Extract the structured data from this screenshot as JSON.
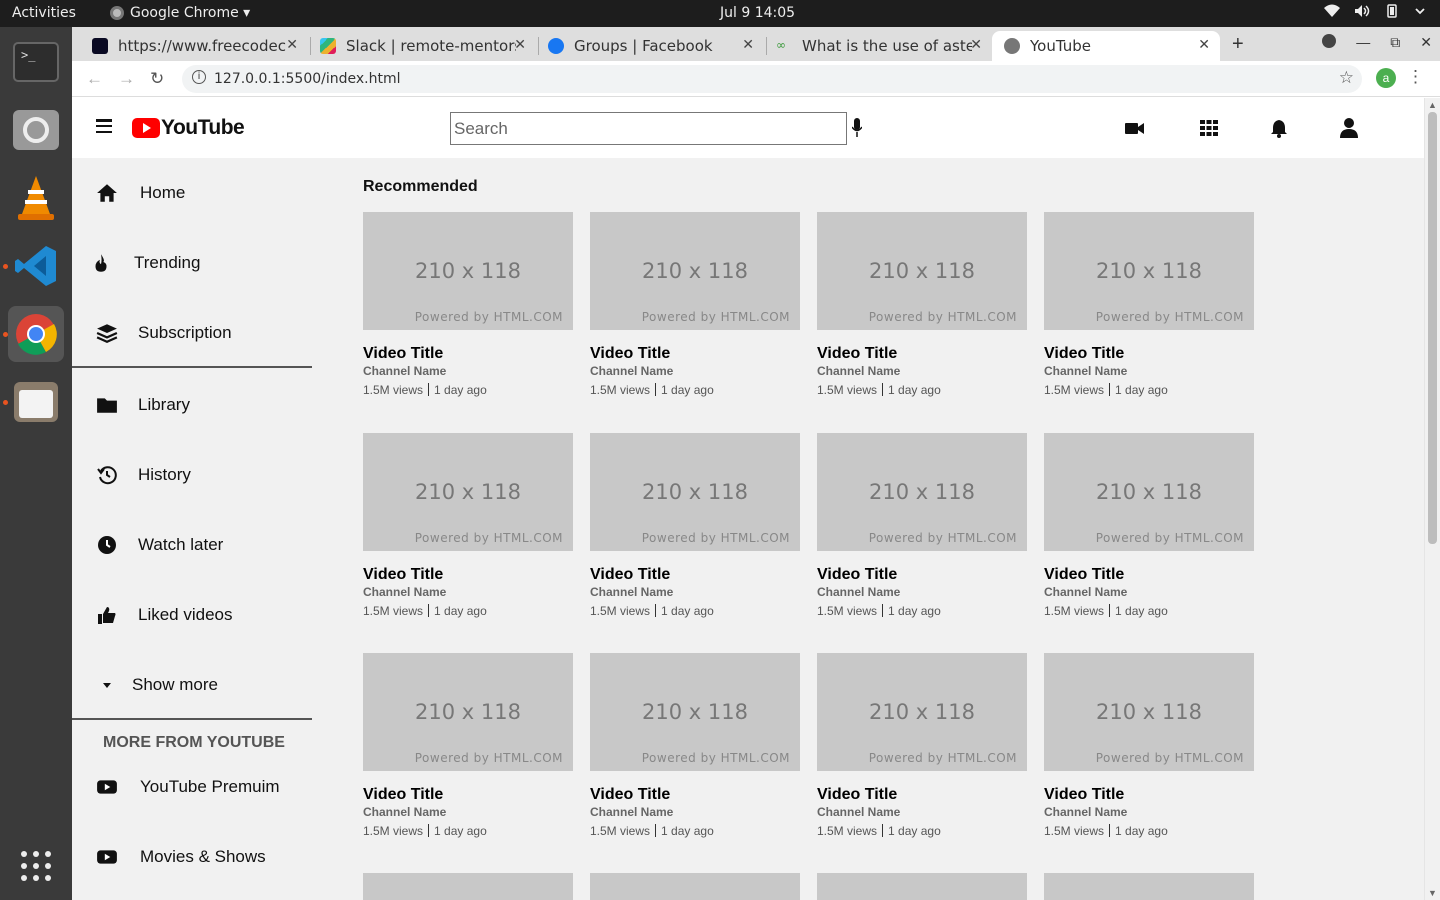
{
  "topbar": {
    "activities": "Activities",
    "app_name": "Google Chrome ▾",
    "datetime": "Jul 9  14:05",
    "tray": [
      "wifi-icon",
      "volume-icon",
      "battery-icon",
      "power-menu-icon"
    ]
  },
  "dock": {
    "items": [
      "terminal",
      "screenshot-tool",
      "vlc",
      "vscode",
      "chrome",
      "files"
    ],
    "show_apps": "show-applications-icon"
  },
  "tabs": [
    {
      "title": "https://www.freecodec",
      "favicon_color": "#0a0a23"
    },
    {
      "title": "Slack | remote-mentorsh",
      "favicon_color": "#e01e5a"
    },
    {
      "title": "Groups | Facebook",
      "favicon_color": "#1877f2"
    },
    {
      "title": "What is the use of aster",
      "favicon_color": "#3c9a3c"
    },
    {
      "title": "YouTube",
      "favicon_color": "#777777"
    }
  ],
  "address": {
    "url": "127.0.0.1:5500/index.html",
    "profile_initial": "a"
  },
  "header": {
    "logo_text": "YouTube",
    "search_placeholder": "Search"
  },
  "sidebar": {
    "primary": [
      {
        "label": "Home",
        "icon": "home-icon"
      },
      {
        "label": "Trending",
        "icon": "fire-icon"
      },
      {
        "label": "Subscription",
        "icon": "layers-icon"
      }
    ],
    "secondary": [
      {
        "label": "Library",
        "icon": "folder-icon"
      },
      {
        "label": "History",
        "icon": "history-icon"
      },
      {
        "label": "Watch later",
        "icon": "clock-icon"
      },
      {
        "label": "Liked videos",
        "icon": "thumbs-up-icon"
      },
      {
        "label": "Show more",
        "icon": "caret-down-icon"
      }
    ],
    "more_heading": "MORE FROM YOUTUBE",
    "more": [
      {
        "label": "YouTube Premuim",
        "icon": "youtube-icon"
      },
      {
        "label": "Movies & Shows",
        "icon": "youtube-icon"
      }
    ]
  },
  "main": {
    "section_title": "Recommended",
    "placeholder_size": "210 x 118",
    "placeholder_credit": "Powered by HTML.COM",
    "videos": [
      {
        "title": "Video Title",
        "channel": "Channel Name",
        "views": "1.5M views",
        "age": "1 day ago"
      },
      {
        "title": "Video Title",
        "channel": "Channel Name",
        "views": "1.5M views",
        "age": "1 day ago"
      },
      {
        "title": "Video Title",
        "channel": "Channel Name",
        "views": "1.5M views",
        "age": "1 day ago"
      },
      {
        "title": "Video Title",
        "channel": "Channel Name",
        "views": "1.5M views",
        "age": "1 day ago"
      },
      {
        "title": "Video Title",
        "channel": "Channel Name",
        "views": "1.5M views",
        "age": "1 day ago"
      },
      {
        "title": "Video Title",
        "channel": "Channel Name",
        "views": "1.5M views",
        "age": "1 day ago"
      },
      {
        "title": "Video Title",
        "channel": "Channel Name",
        "views": "1.5M views",
        "age": "1 day ago"
      },
      {
        "title": "Video Title",
        "channel": "Channel Name",
        "views": "1.5M views",
        "age": "1 day ago"
      },
      {
        "title": "Video Title",
        "channel": "Channel Name",
        "views": "1.5M views",
        "age": "1 day ago"
      },
      {
        "title": "Video Title",
        "channel": "Channel Name",
        "views": "1.5M views",
        "age": "1 day ago"
      },
      {
        "title": "Video Title",
        "channel": "Channel Name",
        "views": "1.5M views",
        "age": "1 day ago"
      },
      {
        "title": "Video Title",
        "channel": "Channel Name",
        "views": "1.5M views",
        "age": "1 day ago"
      }
    ]
  }
}
